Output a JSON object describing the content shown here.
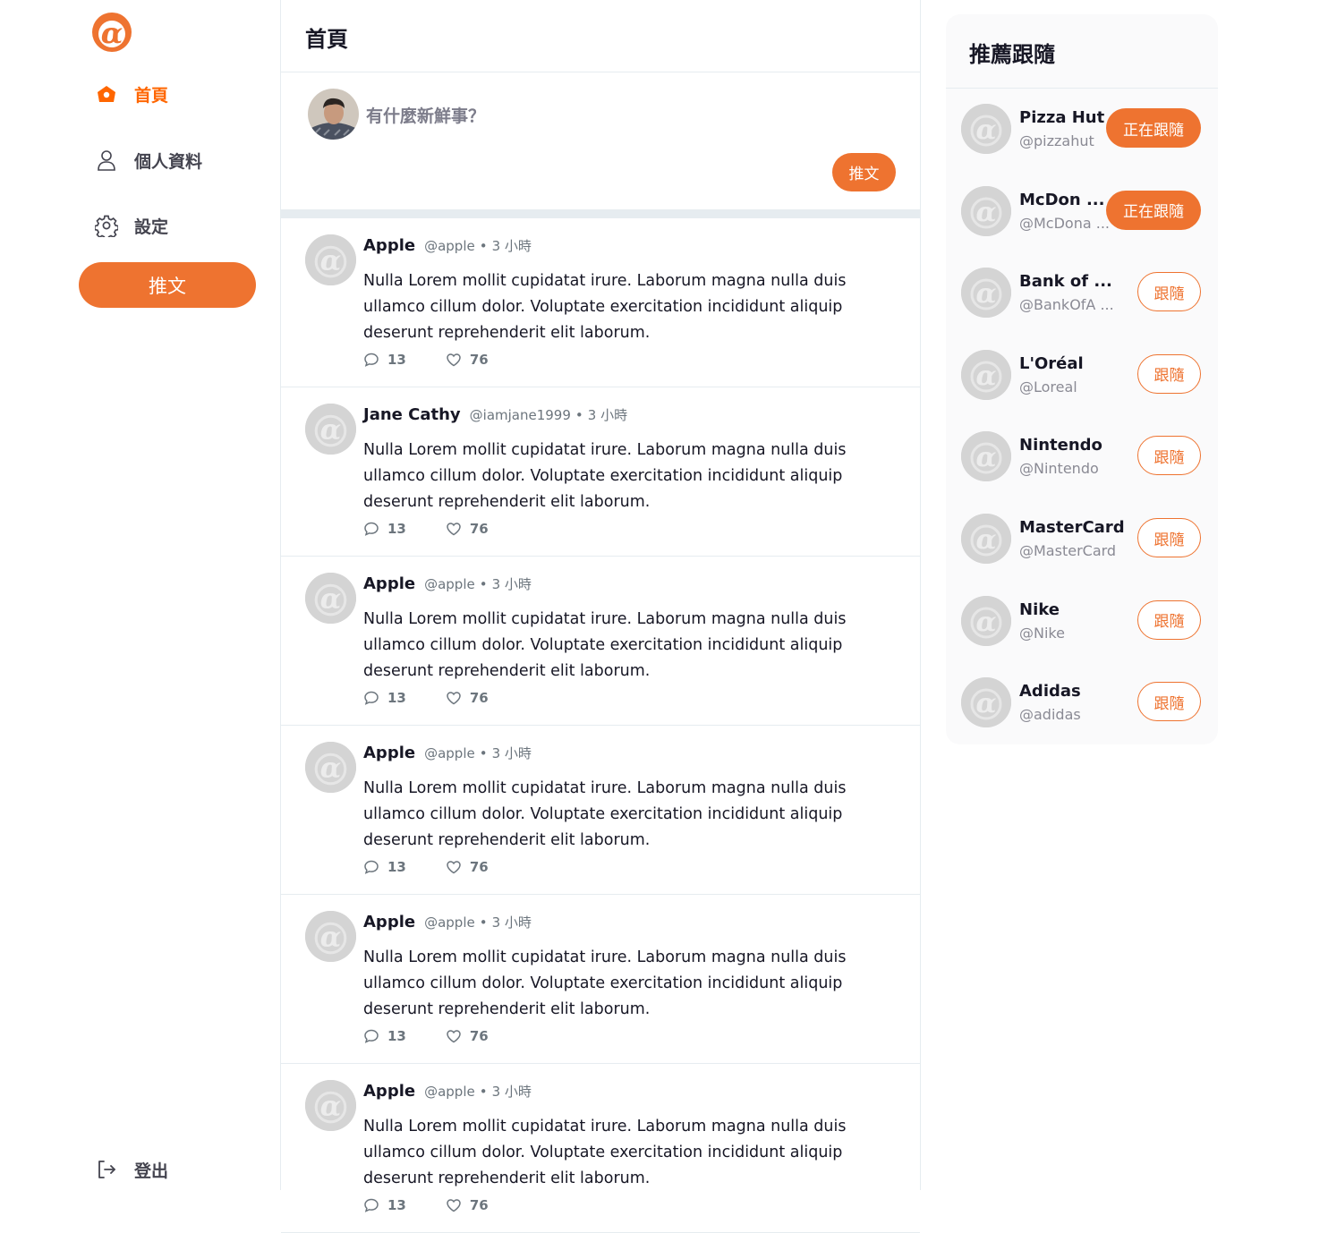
{
  "colors": {
    "accent": "#EE7330",
    "accent_active_text": "#FF6600",
    "text": "#171725",
    "muted": "#6C757D",
    "avatar_placeholder": "#D4D4D4"
  },
  "brand": {
    "logo_icon": "alpha-logo-icon"
  },
  "sidebar": {
    "nav": [
      {
        "label": "首頁",
        "icon": "home-icon",
        "active": true
      },
      {
        "label": "個人資料",
        "icon": "user-icon",
        "active": false
      },
      {
        "label": "設定",
        "icon": "gear-icon",
        "active": false
      }
    ],
    "tweet_button": "推文",
    "logout": {
      "label": "登出",
      "icon": "logout-icon"
    }
  },
  "main": {
    "title": "首頁",
    "composer": {
      "placeholder": "有什麼新鮮事？",
      "submit": "推文"
    },
    "tweets": [
      {
        "name": "Apple",
        "handle": "@apple",
        "dot": "•",
        "time": "3 小時",
        "body": "Nulla Lorem mollit cupidatat irure. Laborum magna nulla duis ullamco cillum dolor. Voluptate exercitation incididunt aliquip deserunt reprehenderit elit laborum.",
        "replies": "13",
        "likes": "76"
      },
      {
        "name": "Jane Cathy",
        "handle": "@iamjane1999",
        "dot": "•",
        "time": "3 小時",
        "body": "Nulla Lorem mollit cupidatat irure. Laborum magna nulla duis ullamco cillum dolor. Voluptate exercitation incididunt aliquip deserunt reprehenderit elit laborum.",
        "replies": "13",
        "likes": "76"
      },
      {
        "name": "Apple",
        "handle": "@apple",
        "dot": "•",
        "time": "3 小時",
        "body": "Nulla Lorem mollit cupidatat irure. Laborum magna nulla duis ullamco cillum dolor. Voluptate exercitation incididunt aliquip deserunt reprehenderit elit laborum.",
        "replies": "13",
        "likes": "76"
      },
      {
        "name": "Apple",
        "handle": "@apple",
        "dot": "•",
        "time": "3 小時",
        "body": "Nulla Lorem mollit cupidatat irure. Laborum magna nulla duis ullamco cillum dolor. Voluptate exercitation incididunt aliquip deserunt reprehenderit elit laborum.",
        "replies": "13",
        "likes": "76"
      },
      {
        "name": "Apple",
        "handle": "@apple",
        "dot": "•",
        "time": "3 小時",
        "body": "Nulla Lorem mollit cupidatat irure. Laborum magna nulla duis ullamco cillum dolor. Voluptate exercitation incididunt aliquip deserunt reprehenderit elit laborum.",
        "replies": "13",
        "likes": "76"
      },
      {
        "name": "Apple",
        "handle": "@apple",
        "dot": "•",
        "time": "3 小時",
        "body": "Nulla Lorem mollit cupidatat irure. Laborum magna nulla duis ullamco cillum dolor. Voluptate exercitation incididunt aliquip deserunt reprehenderit elit laborum.",
        "replies": "13",
        "likes": "76"
      }
    ]
  },
  "recommend": {
    "title": "推薦跟隨",
    "users": [
      {
        "name": "Pizza Hut",
        "handle": "@pizzahut",
        "button": "正在跟隨",
        "following": true
      },
      {
        "name": "McDon ...",
        "handle": "@McDona ...",
        "button": "正在跟隨",
        "following": true
      },
      {
        "name": "Bank of  ...",
        "handle": "@BankOfA ...",
        "button": "跟隨",
        "following": false
      },
      {
        "name": "L'Oréal",
        "handle": "@Loreal",
        "button": "跟隨",
        "following": false
      },
      {
        "name": "Nintendo",
        "handle": "@Nintendo",
        "button": "跟隨",
        "following": false
      },
      {
        "name": "MasterCard",
        "handle": "@MasterCard",
        "button": "跟隨",
        "following": false
      },
      {
        "name": "Nike",
        "handle": "@Nike",
        "button": "跟隨",
        "following": false
      },
      {
        "name": "Adidas",
        "handle": "@adidas",
        "button": "跟隨",
        "following": false
      }
    ]
  }
}
